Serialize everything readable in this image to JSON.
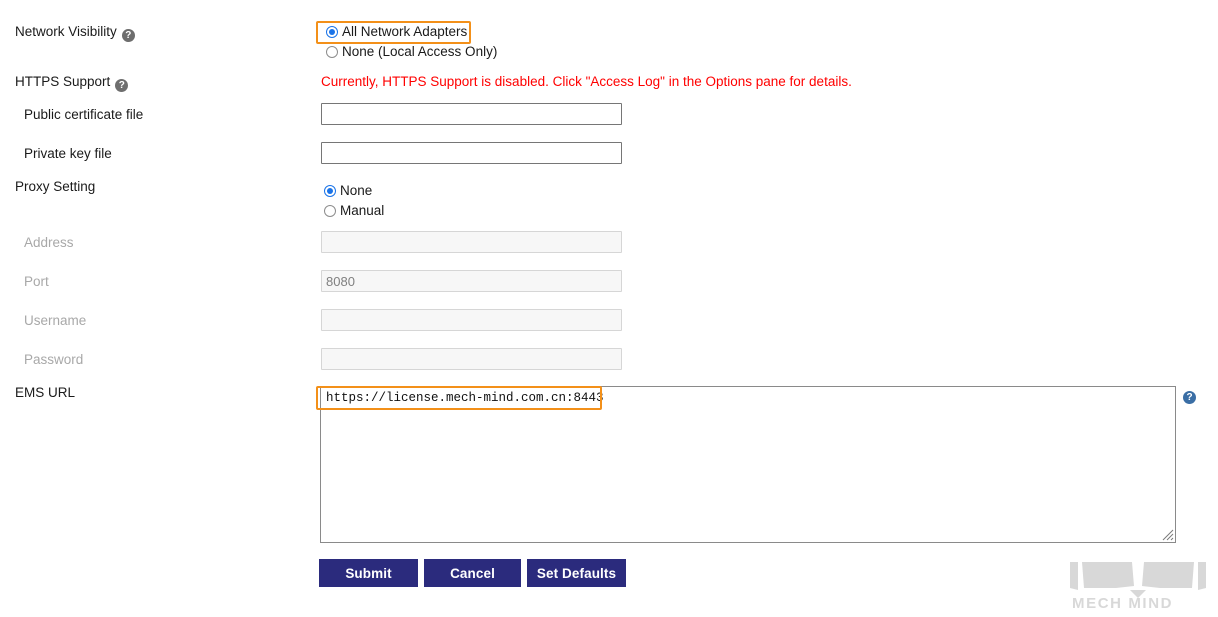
{
  "form": {
    "network_visibility": {
      "label": "Network Visibility",
      "help_icon": "help-circle-icon",
      "options": [
        {
          "label": "All Network Adapters",
          "selected": true
        },
        {
          "label": "None (Local Access Only)",
          "selected": false
        }
      ]
    },
    "https_support": {
      "label": "HTTPS Support",
      "help_icon": "help-circle-icon",
      "warning": "Currently, HTTPS Support is disabled. Click \"Access Log\" in the Options pane for details.",
      "warning_color": "#ff0000"
    },
    "public_certificate_file": {
      "label": "Public certificate file",
      "value": "",
      "disabled": false
    },
    "private_key_file": {
      "label": "Private key file",
      "value": "",
      "disabled": false
    },
    "proxy_setting": {
      "label": "Proxy Setting",
      "options": [
        {
          "label": "None",
          "selected": true
        },
        {
          "label": "Manual",
          "selected": false
        }
      ]
    },
    "address": {
      "label": "Address",
      "value": "",
      "disabled": true
    },
    "port": {
      "label": "Port",
      "value": "8080",
      "disabled": true
    },
    "username": {
      "label": "Username",
      "value": "",
      "disabled": true
    },
    "password": {
      "label": "Password",
      "value": "",
      "disabled": true
    },
    "ems_url": {
      "label": "EMS URL",
      "value": "https://license.mech-mind.com.cn:8443",
      "help_icon": "help-circle-icon"
    }
  },
  "buttons": {
    "submit": "Submit",
    "cancel": "Cancel",
    "set_defaults": "Set Defaults",
    "color": "#2b2b7d"
  },
  "annotations": {
    "color": "#f39019",
    "highlight_network_option": "All Network Adapters",
    "highlight_ems_value": "https://license.mech-mind.com.cn:8443"
  },
  "branding": {
    "logo_text": "MECH MIND",
    "logo_color": "#d8d8d8"
  }
}
